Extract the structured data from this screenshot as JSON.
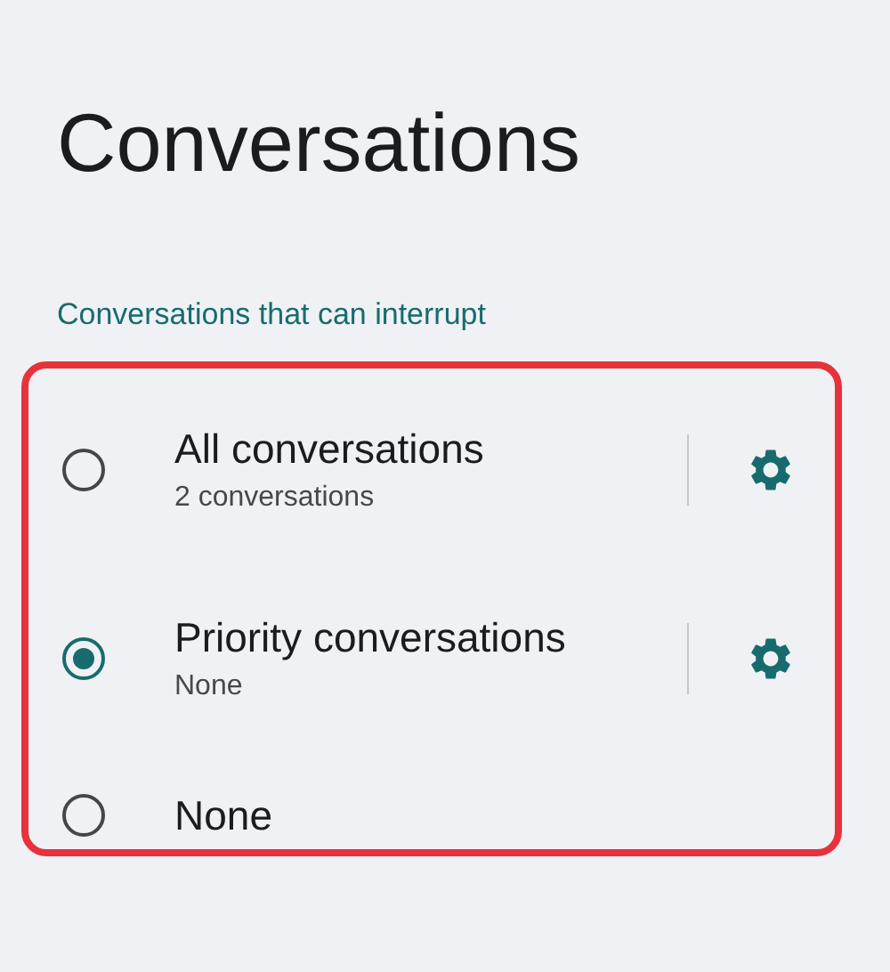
{
  "title": "Conversations",
  "section_header": "Conversations that can interrupt",
  "options": [
    {
      "kind": "with-settings",
      "label": "All conversations",
      "summary": "2 conversations",
      "selected": false
    },
    {
      "kind": "with-settings",
      "label": "Priority conversations",
      "summary": "None",
      "selected": true
    },
    {
      "kind": "plain",
      "label": "None",
      "selected": false
    }
  ]
}
